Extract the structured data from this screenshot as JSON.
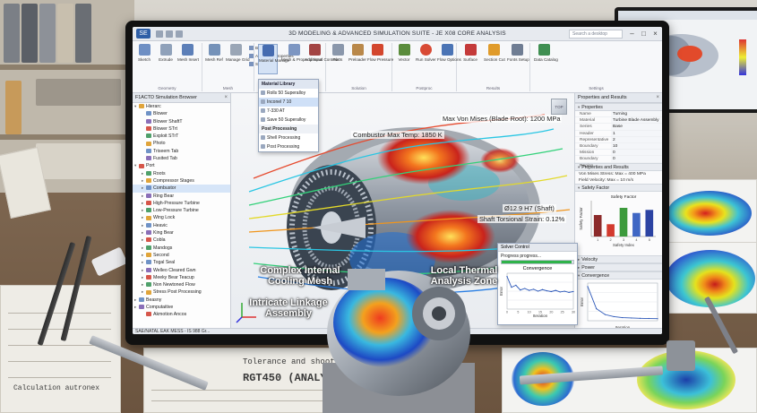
{
  "window": {
    "title": "3D MODELING & ADVANCED SIMULATION SUITE - JE X08 CORE ANALYSIS",
    "app_badge": "SE",
    "search_placeholder": "Search a desktop"
  },
  "ribbon": {
    "buttons": [
      {
        "label": "Sketch",
        "icon": "sketch-icon"
      },
      {
        "label": "Extrude",
        "icon": "extrude-icon"
      },
      {
        "label": "Mesh Insert",
        "icon": "mesh-icon"
      },
      {
        "label": "Mesh Ref",
        "icon": "mesh-ref-icon"
      },
      {
        "label": "Manage Grid",
        "icon": "grid-icon"
      },
      {
        "label": "Material Manage",
        "icon": "material-icon"
      },
      {
        "label": "Mesh & Property Input",
        "icon": "property-icon"
      },
      {
        "label": "Additional Controls",
        "icon": "controls-icon"
      },
      {
        "label": "Parts",
        "icon": "parts-icon"
      },
      {
        "label": "Preloader",
        "icon": "preload-icon"
      },
      {
        "label": "Flow Pressure",
        "icon": "flow-icon"
      },
      {
        "label": "Vector",
        "icon": "vector-icon"
      },
      {
        "label": "Run Solver",
        "icon": "run-icon"
      },
      {
        "label": "Flow Options",
        "icon": "options-icon"
      },
      {
        "label": "Surface",
        "icon": "surface-icon"
      },
      {
        "label": "Section Cut",
        "icon": "section-icon"
      },
      {
        "label": "Fonts Setup",
        "icon": "fonts-icon"
      },
      {
        "label": "Data Catalog",
        "icon": "catalog-icon"
      }
    ],
    "small": [
      "BodyControl",
      "Advanced Properties",
      "Symmetries"
    ],
    "groups": [
      "Geometry",
      "Mesh",
      "Loads",
      "Solution",
      "Postproc",
      "Results",
      "Settings"
    ]
  },
  "material_menu": {
    "header": "Material Library",
    "items": [
      "Rolls 50 Superalloy",
      "Inconel 7 10",
      "7-330 AT",
      "Save 50 Superalloy"
    ],
    "selected": "Inconel 7 10",
    "sub_header": "Post Processing",
    "sub_items": [
      "Shell Processing",
      "Post Processing"
    ]
  },
  "browser": {
    "title": "F1ACTD Simulation Browser",
    "rows": [
      {
        "label": "Hierarc",
        "depth": 0,
        "tw": "▾"
      },
      {
        "label": "Blower",
        "depth": 1,
        "tw": ""
      },
      {
        "label": "Blower ShaftT",
        "depth": 1,
        "tw": ""
      },
      {
        "label": "Blower STrt",
        "depth": 1,
        "tw": ""
      },
      {
        "label": "Exploit STrT",
        "depth": 1,
        "tw": ""
      },
      {
        "label": "Photo",
        "depth": 1,
        "tw": ""
      },
      {
        "label": "Triseem Tab",
        "depth": 1,
        "tw": ""
      },
      {
        "label": "Fusited Tab",
        "depth": 1,
        "tw": ""
      },
      {
        "label": "Port",
        "depth": 0,
        "tw": "▾"
      },
      {
        "label": "Roots",
        "depth": 1,
        "tw": "▸"
      },
      {
        "label": "Compressor Stages",
        "depth": 1,
        "tw": "▸"
      },
      {
        "label": "Combustor",
        "depth": 1,
        "tw": "▸"
      },
      {
        "label": "Ring Bear",
        "depth": 1,
        "tw": "▸"
      },
      {
        "label": "High-Pressure Turbine",
        "depth": 1,
        "tw": "▸"
      },
      {
        "label": "Low-Pressure Turbine",
        "depth": 1,
        "tw": "▸"
      },
      {
        "label": "Wing Lock",
        "depth": 1,
        "tw": "▸"
      },
      {
        "label": "Heavic",
        "depth": 1,
        "tw": "▸"
      },
      {
        "label": "King Bear",
        "depth": 1,
        "tw": "▸"
      },
      {
        "label": "Cobla",
        "depth": 1,
        "tw": "▸"
      },
      {
        "label": "Mandogs",
        "depth": 1,
        "tw": "▸"
      },
      {
        "label": "Second",
        "depth": 1,
        "tw": "▸"
      },
      {
        "label": "Togal Seal",
        "depth": 1,
        "tw": "▸"
      },
      {
        "label": "Welleo Cleared Gwn",
        "depth": 1,
        "tw": "▸"
      },
      {
        "label": "Meeky Bear Teacup",
        "depth": 1,
        "tw": "▸"
      },
      {
        "label": "Non Newtoned Flow",
        "depth": 1,
        "tw": "▸"
      },
      {
        "label": "Stress Post Processing",
        "depth": 1,
        "tw": "▸"
      },
      {
        "label": "Beasny",
        "depth": 0,
        "tw": "▸"
      },
      {
        "label": "Computaitive",
        "depth": 0,
        "tw": "▸"
      },
      {
        "label": "Akmotion Ancos",
        "depth": 1,
        "tw": ""
      }
    ]
  },
  "viewport": {
    "callout_max_von_mises": "Max Von Mises (Blade Root): 1200 MPa",
    "callout_combustor": "Combustor Max Temp: 1850 K",
    "callout_shaft": "Ø12.9 H7 (Shaft)",
    "callout_strain": "Shaft Torsional Strain: 0.12%",
    "viewcube_label": "TOP",
    "label_cooling": "Complex Internal Cooling Mesh",
    "label_thermal": "Local Thermal Analysis Zone",
    "label_linkage": "Intricate Linkage Assembly"
  },
  "solver": {
    "title": "Solver Control",
    "progress_label": "Progress progress...",
    "progress_fraction": 0.98,
    "chart_title": "Convergence",
    "xlabel": "Iteration",
    "ylabel": "Error"
  },
  "props": {
    "title": "Properties and Results",
    "section_properties": "Properties",
    "rows": [
      {
        "k": "Name",
        "v": "Turning"
      },
      {
        "k": "Material",
        "v": "Turbine Blade Assembly"
      },
      {
        "k": "Series",
        "v": "Base"
      },
      {
        "k": "Header",
        "v": "1"
      },
      {
        "k": "Representative",
        "v": "2"
      },
      {
        "k": "Boundary",
        "v": "10"
      },
      {
        "k": "Mission",
        "v": "0"
      },
      {
        "k": "Boundary Region",
        "v": "0"
      }
    ],
    "section_results": "Properties and Results",
    "result_line1": "Von Mises Stress: Max = 400 MPa",
    "result_line2": "Field Velocity: Max = 10 m/s",
    "section_safety": "Safety Factor",
    "safety_chart_title": "Safety Factor",
    "safety_xlabel": "Safety Index",
    "safety_ylabel": "Safety Factor",
    "section_a": "Velocity",
    "section_b": "Power",
    "section_convergence": "Convergence",
    "conv_xlabel": "Iteration",
    "conv_ylabel": "Error"
  },
  "statusbar": {
    "text": "SAE/NATAL EAK MESS - IS 988 Gr..."
  },
  "desk": {
    "paper_left_text": "Calculation autronex",
    "paper_center_title": "Tolerance and shoot",
    "paper_center_code": "RGT450 (ANALYSIS)"
  },
  "chart_data": [
    {
      "type": "line",
      "title": "Convergence",
      "xlabel": "Iteration",
      "ylabel": "Error",
      "x": [
        0,
        2,
        4,
        6,
        8,
        10,
        12,
        14,
        16,
        18,
        20,
        22,
        24,
        26,
        28,
        30
      ],
      "series": [
        {
          "values": [
            0.82,
            0.55,
            0.6,
            0.48,
            0.52,
            0.47,
            0.5,
            0.45,
            0.49,
            0.46,
            0.44,
            0.47,
            0.43,
            0.45,
            0.42,
            0.44
          ]
        }
      ],
      "xticks": [
        "0",
        "5",
        "10",
        "15",
        "20",
        "25",
        "30"
      ],
      "grid": true
    },
    {
      "type": "bar",
      "title": "Safety Factor",
      "xlabel": "Safety Index",
      "ylabel": "Safety Factor",
      "categories": [
        "1",
        "2",
        "3",
        "4",
        "5"
      ],
      "values": [
        2.1,
        1.2,
        2.8,
        2.3,
        2.6
      ],
      "colors": [
        "#8c2a2a",
        "#d33a2e",
        "#3c9a3c",
        "#3f66c4",
        "#2c43a3"
      ],
      "ylim": [
        0,
        3.5
      ]
    },
    {
      "type": "line",
      "title": "Convergence",
      "xlabel": "Iteration",
      "ylabel": "Error",
      "x": [
        0,
        5,
        10,
        15,
        20,
        25,
        30,
        35,
        40
      ],
      "series": [
        {
          "values": [
            1.0,
            0.35,
            0.18,
            0.12,
            0.09,
            0.08,
            0.07,
            0.065,
            0.06
          ]
        }
      ],
      "grid": true
    }
  ],
  "colors": {
    "accent": "#2f5fa7",
    "progress": "#2fb34a",
    "hot": "#d9351b",
    "cool": "#1f6fd6"
  }
}
